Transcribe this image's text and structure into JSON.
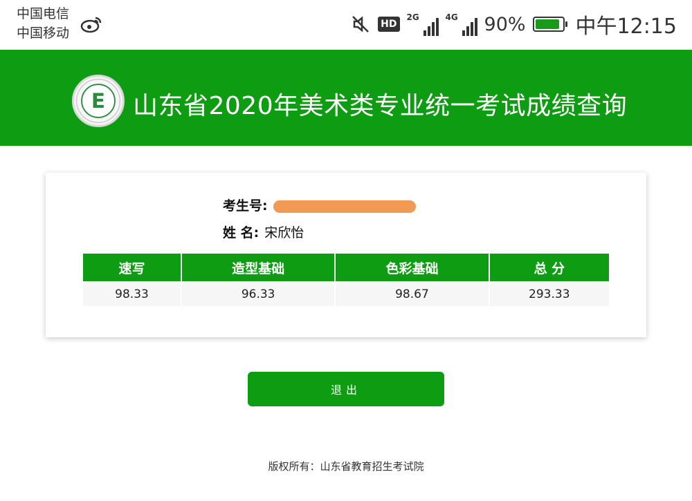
{
  "status_bar": {
    "carrier_1": "中国电信",
    "carrier_2": "中国移动",
    "hd_badge": "HD",
    "signal_1_label": "2G",
    "signal_2_label": "4G",
    "battery_percent": "90%",
    "battery_level": 0.9,
    "time": "中午12:15",
    "icons": [
      "weibo-icon",
      "mute-icon",
      "hd-badge",
      "signal-2g-icon",
      "signal-4g-icon",
      "battery-charging-icon"
    ]
  },
  "banner": {
    "title": "山东省2020年美术类专业统一考试成绩查询",
    "logo_letter": "E",
    "background_color": "#0e9c13"
  },
  "candidate": {
    "exam_no_label": "考生号:",
    "name_label": "姓 名:",
    "name_value": "宋欣怡"
  },
  "scores": {
    "headers": [
      "速写",
      "造型基础",
      "色彩基础",
      "总 分"
    ],
    "values": [
      "98.33",
      "96.33",
      "98.67",
      "293.33"
    ]
  },
  "exit_button_label": "退出",
  "footer": "版权所有：山东省教育招生考试院"
}
